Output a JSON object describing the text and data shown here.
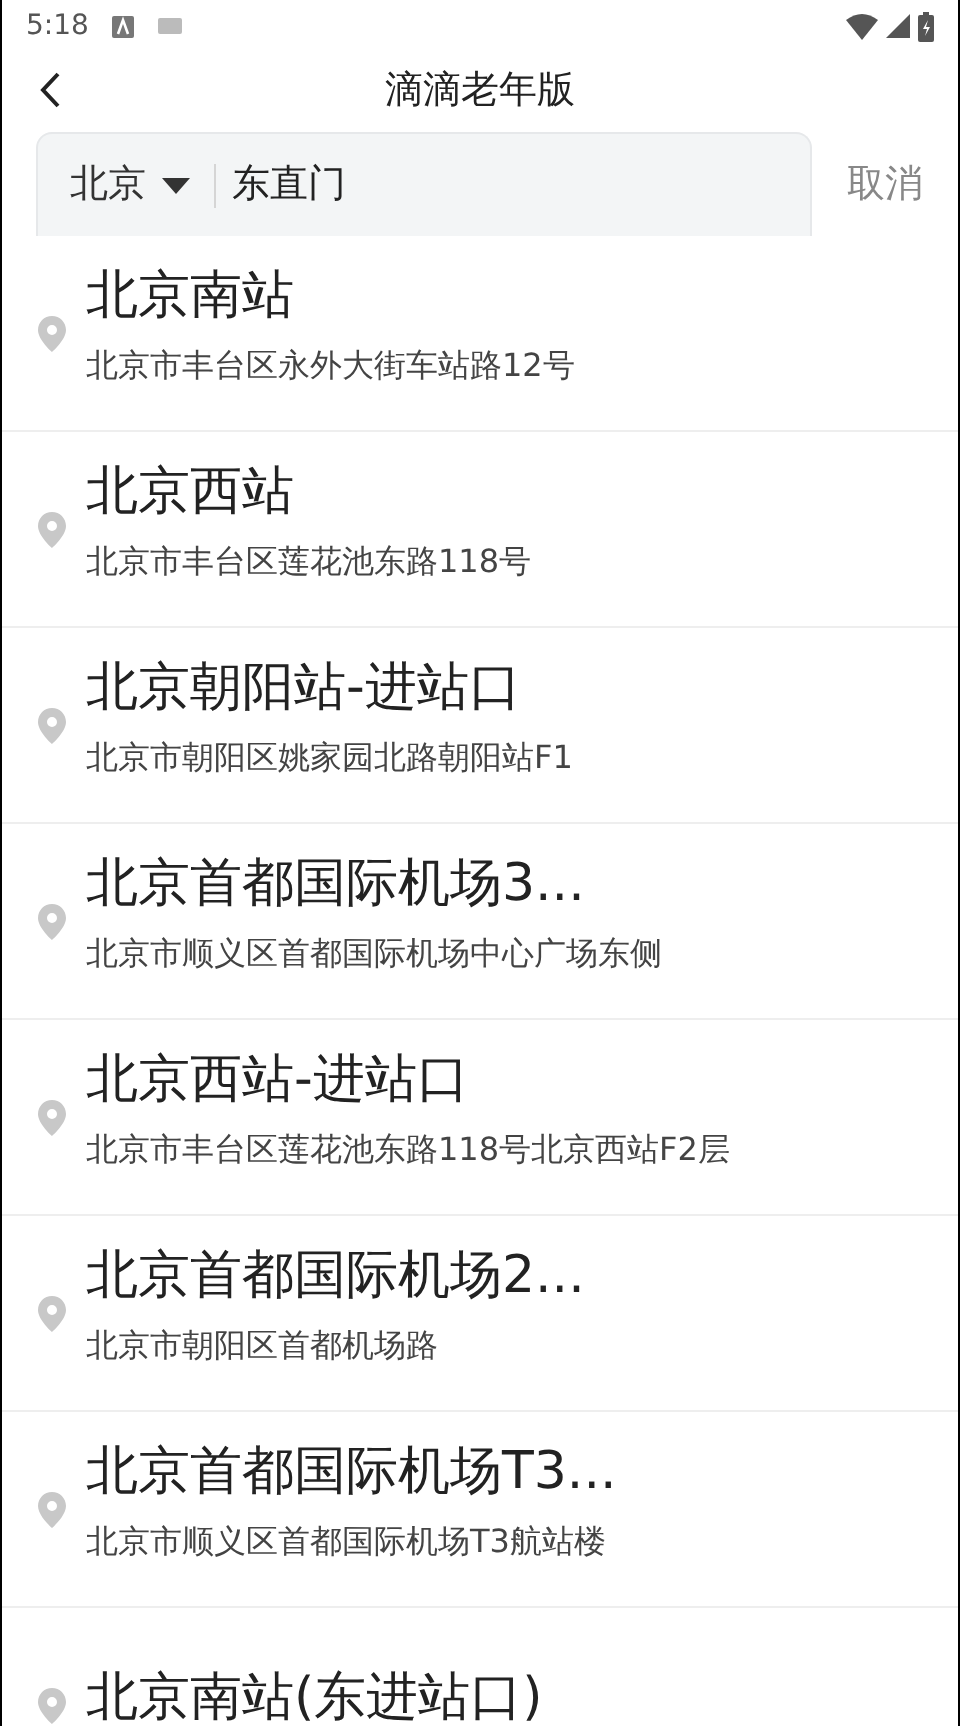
{
  "status_bar": {
    "time": "5:18"
  },
  "header": {
    "title": "滴滴老年版"
  },
  "search": {
    "city": "北京",
    "value": "东直门",
    "cancel": "取消"
  },
  "results": [
    {
      "name": "北京南站",
      "address": "北京市丰台区永外大街车站路12号"
    },
    {
      "name": "北京西站",
      "address": "北京市丰台区莲花池东路118号"
    },
    {
      "name": "北京朝阳站-进站口",
      "address": "北京市朝阳区姚家园北路朝阳站F1"
    },
    {
      "name": "北京首都国际机场3...",
      "address": "北京市顺义区首都国际机场中心广场东侧"
    },
    {
      "name": "北京西站-进站口",
      "address": "北京市丰台区莲花池东路118号北京西站F2层"
    },
    {
      "name": "北京首都国际机场2...",
      "address": "北京市朝阳区首都机场路"
    },
    {
      "name": "北京首都国际机场T3...",
      "address": "北京市顺义区首都国际机场T3航站楼"
    },
    {
      "name": "北京南站(东进站口)"
    }
  ]
}
